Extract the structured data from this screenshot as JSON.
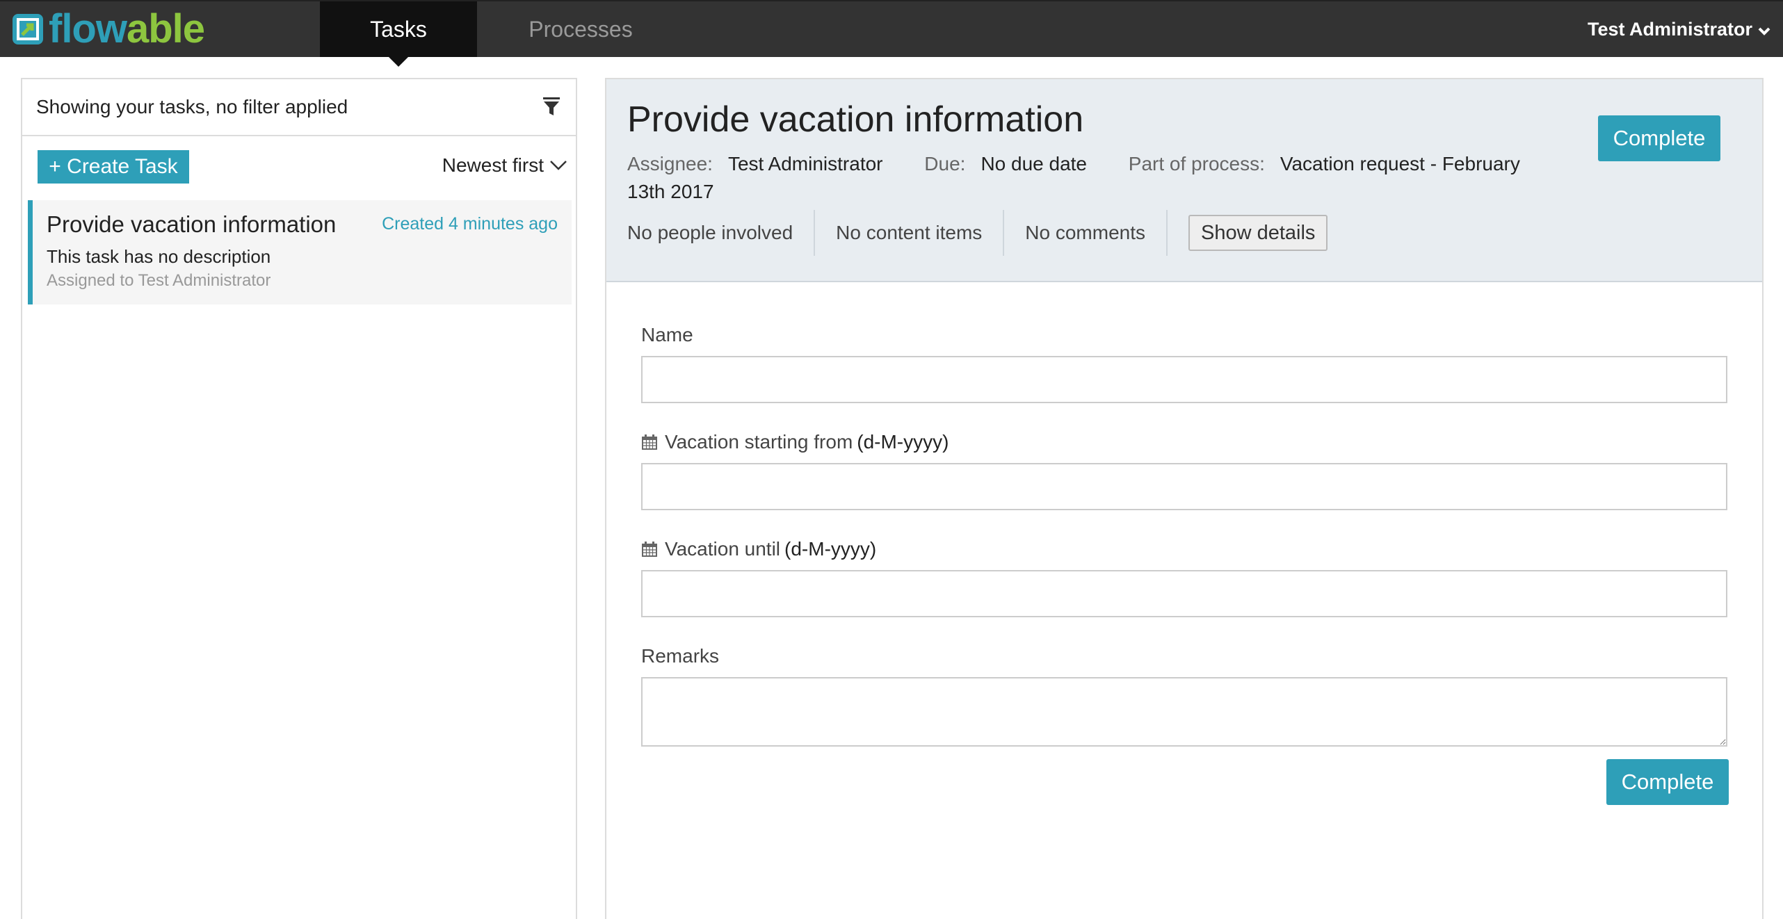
{
  "brand": {
    "logo_part1": "flow",
    "logo_part2": "able",
    "primary_color": "#2e9fb8",
    "secondary_color": "#8dc63f"
  },
  "nav": {
    "tabs": [
      {
        "label": "Tasks",
        "active": true
      },
      {
        "label": "Processes",
        "active": false
      }
    ],
    "user_name": "Test Administrator"
  },
  "task_list": {
    "filter_text": "Showing your tasks, no filter applied",
    "create_label": "+ Create Task",
    "sort_label": "Newest first",
    "items": [
      {
        "title": "Provide vacation information",
        "created": "Created 4 minutes ago",
        "description": "This task has no description",
        "assigned": "Assigned to Test Administrator"
      }
    ]
  },
  "task_detail": {
    "title": "Provide vacation information",
    "assignee_label": "Assignee:",
    "assignee": "Test Administrator",
    "due_label": "Due:",
    "due": "No due date",
    "process_label": "Part of process:",
    "process": "Vacation request - February 13th 2017",
    "complete_label": "Complete",
    "people": "No people involved",
    "content": "No content items",
    "comments": "No comments",
    "show_details": "Show details"
  },
  "form": {
    "fields": [
      {
        "label": "Name",
        "format": "",
        "value": ""
      },
      {
        "label": "Vacation starting from",
        "format": "(d-M-yyyy)",
        "value": ""
      },
      {
        "label": "Vacation until",
        "format": "(d-M-yyyy)",
        "value": ""
      },
      {
        "label": "Remarks",
        "format": "",
        "value": ""
      }
    ],
    "complete_label": "Complete"
  }
}
